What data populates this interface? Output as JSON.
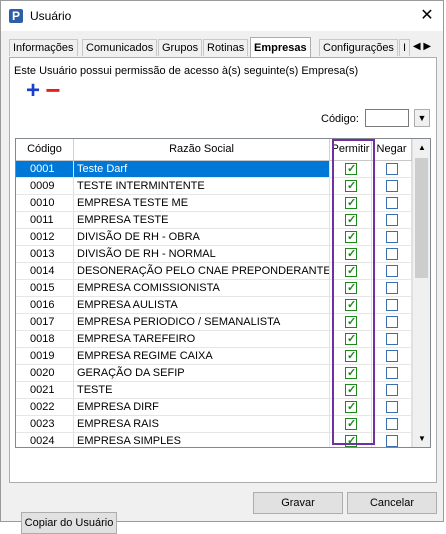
{
  "window": {
    "title": "Usuário",
    "close_glyph": "✕",
    "icon_letter": "P"
  },
  "tabs": [
    {
      "label": "Informações"
    },
    {
      "label": "Comunicados"
    },
    {
      "label": "Grupos"
    },
    {
      "label": "Rotinas"
    },
    {
      "label": "Empresas"
    },
    {
      "label": "Configurações"
    },
    {
      "label": "I"
    }
  ],
  "panel": {
    "info_text": "Este Usuário possui permissão de acesso à(s) seguinte(s) Empresa(s)",
    "add_glyph": "+",
    "remove_glyph": "−",
    "code_label": "Código:",
    "code_value": ""
  },
  "grid": {
    "columns": [
      "Código",
      "Razão Social",
      "Permitir",
      "Negar"
    ],
    "rows": [
      {
        "code": "0001",
        "name": "Teste Darf",
        "permitir": true,
        "negar": false
      },
      {
        "code": "0009",
        "name": "TESTE INTERMINTENTE",
        "permitir": true,
        "negar": false
      },
      {
        "code": "0010",
        "name": "EMPRESA TESTE ME",
        "permitir": true,
        "negar": false
      },
      {
        "code": "0011",
        "name": "EMPRESA TESTE",
        "permitir": true,
        "negar": false
      },
      {
        "code": "0012",
        "name": "DIVISÃO DE RH - OBRA",
        "permitir": true,
        "negar": false
      },
      {
        "code": "0013",
        "name": "DIVISÃO DE RH - NORMAL",
        "permitir": true,
        "negar": false
      },
      {
        "code": "0014",
        "name": "DESONERAÇÃO PELO CNAE PREPONDERANTE",
        "permitir": true,
        "negar": false
      },
      {
        "code": "0015",
        "name": "EMPRESA COMISSIONISTA",
        "permitir": true,
        "negar": false
      },
      {
        "code": "0016",
        "name": "EMPRESA AULISTA",
        "permitir": true,
        "negar": false
      },
      {
        "code": "0017",
        "name": "EMPRESA PERIODICO / SEMANALISTA",
        "permitir": true,
        "negar": false
      },
      {
        "code": "0018",
        "name": "EMPRESA TAREFEIRO",
        "permitir": true,
        "negar": false
      },
      {
        "code": "0019",
        "name": "EMPRESA REGIME CAIXA",
        "permitir": true,
        "negar": false
      },
      {
        "code": "0020",
        "name": "GERAÇÃO DA SEFIP",
        "permitir": true,
        "negar": false
      },
      {
        "code": "0021",
        "name": "TESTE",
        "permitir": true,
        "negar": false
      },
      {
        "code": "0022",
        "name": "EMPRESA DIRF",
        "permitir": true,
        "negar": false
      },
      {
        "code": "0023",
        "name": "EMPRESA RAIS",
        "permitir": true,
        "negar": false
      },
      {
        "code": "0024",
        "name": "EMPRESA SIMPLES",
        "permitir": true,
        "negar": false
      }
    ],
    "selected_row": 0
  },
  "buttons": {
    "copy_label": "Copiar do Usuário",
    "save_label": "Gravar",
    "cancel_label": "Cancelar"
  },
  "colors": {
    "selection": "#0078d7",
    "highlight_border": "#7030a0",
    "add": "#1a3fc9",
    "remove": "#e02020"
  }
}
